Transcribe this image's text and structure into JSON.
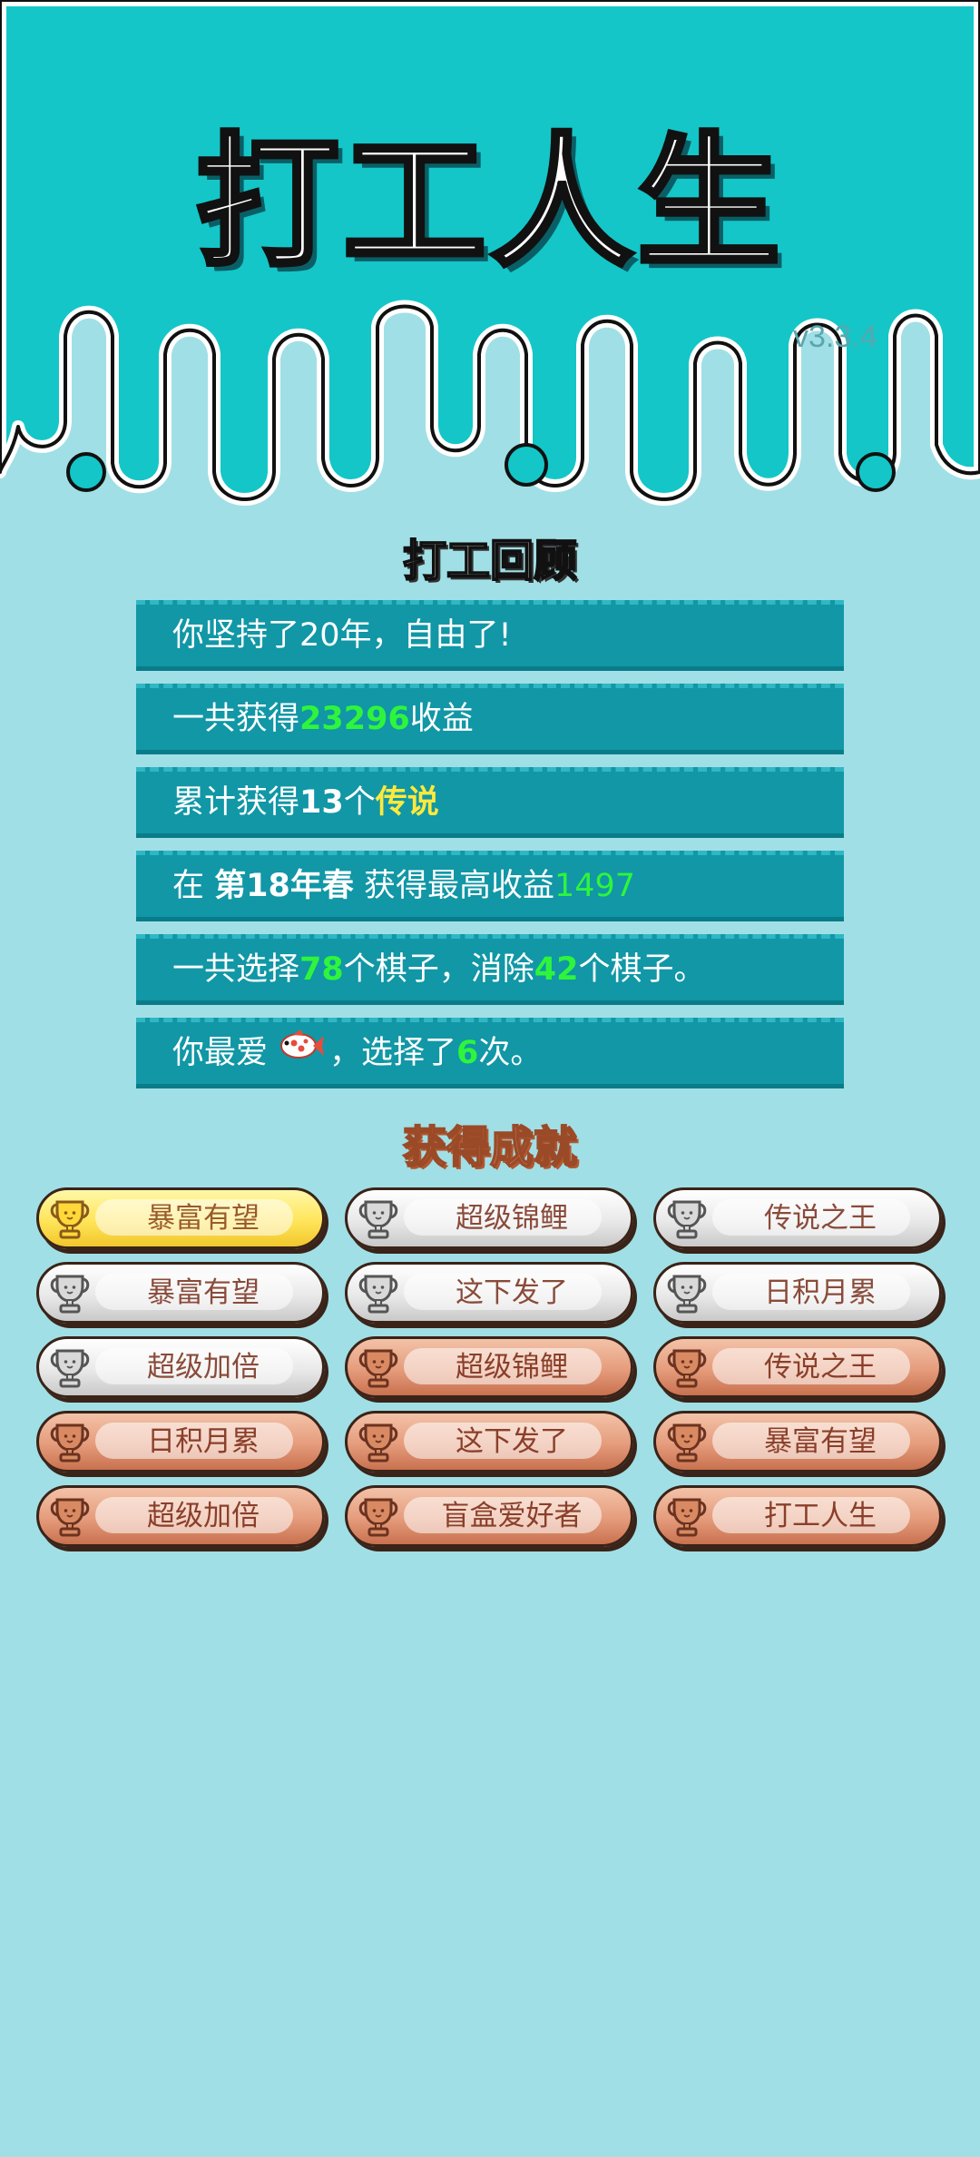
{
  "app": {
    "title": "打工人生",
    "version": "v3.3.4"
  },
  "colors": {
    "header_teal": "#14c6c8",
    "page_background": "#a1dfe6",
    "bar_background": "#1197a6",
    "highlight_green": "#2ef53c",
    "highlight_yellow": "#ffe93d"
  },
  "review": {
    "title": "打工回顾",
    "lines": [
      {
        "parts": [
          "你坚持了20年，自由了!"
        ]
      },
      {
        "parts": [
          "一共获得",
          "23296",
          "收益"
        ]
      },
      {
        "parts": [
          "累计获得",
          "13",
          "个",
          "传说"
        ]
      },
      {
        "parts": [
          "在 ",
          "第18年春",
          " 获得最高收益",
          "1497"
        ]
      },
      {
        "parts": [
          "一共选择",
          "78",
          "个棋子，消除",
          "42",
          "个棋子。"
        ]
      },
      {
        "parts": [
          "你最爱",
          "fish-icon",
          "，选择了",
          "6",
          "次。"
        ]
      }
    ]
  },
  "achievements": {
    "title": "获得成就",
    "items": [
      {
        "label": "暴富有望",
        "tier": "gold"
      },
      {
        "label": "超级锦鲤",
        "tier": "silver"
      },
      {
        "label": "传说之王",
        "tier": "silver"
      },
      {
        "label": "暴富有望",
        "tier": "silver"
      },
      {
        "label": "这下发了",
        "tier": "silver"
      },
      {
        "label": "日积月累",
        "tier": "silver"
      },
      {
        "label": "超级加倍",
        "tier": "silver"
      },
      {
        "label": "超级锦鲤",
        "tier": "bronze"
      },
      {
        "label": "传说之王",
        "tier": "bronze"
      },
      {
        "label": "日积月累",
        "tier": "bronze"
      },
      {
        "label": "这下发了",
        "tier": "bronze"
      },
      {
        "label": "暴富有望",
        "tier": "bronze"
      },
      {
        "label": "超级加倍",
        "tier": "bronze"
      },
      {
        "label": "盲盒爱好者",
        "tier": "bronze"
      },
      {
        "label": "打工人生",
        "tier": "bronze"
      }
    ]
  }
}
